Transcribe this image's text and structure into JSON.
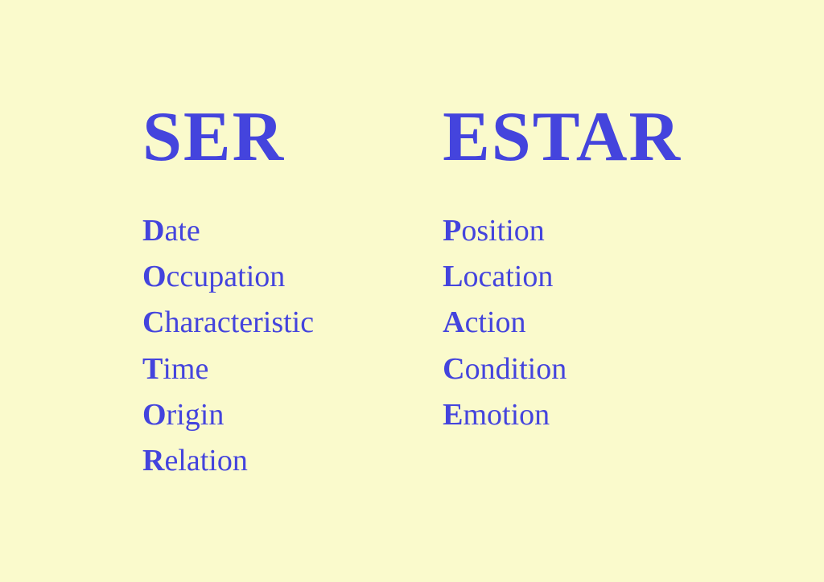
{
  "ser": {
    "title": "SER",
    "items": [
      {
        "letter": "D",
        "rest": "ate"
      },
      {
        "letter": "O",
        "rest": "ccupation"
      },
      {
        "letter": "C",
        "rest": "haracteristic"
      },
      {
        "letter": "T",
        "rest": "ime"
      },
      {
        "letter": "O",
        "rest": "rigin"
      },
      {
        "letter": "R",
        "rest": "elation"
      }
    ]
  },
  "estar": {
    "title": "ESTAR",
    "items": [
      {
        "letter": "P",
        "rest": "osition"
      },
      {
        "letter": "L",
        "rest": "ocation"
      },
      {
        "letter": "A",
        "rest": "ction"
      },
      {
        "letter": "C",
        "rest": "ondition"
      },
      {
        "letter": "E",
        "rest": "motion"
      }
    ]
  },
  "background_color": "#fafacc",
  "accent_color": "#4444dd"
}
